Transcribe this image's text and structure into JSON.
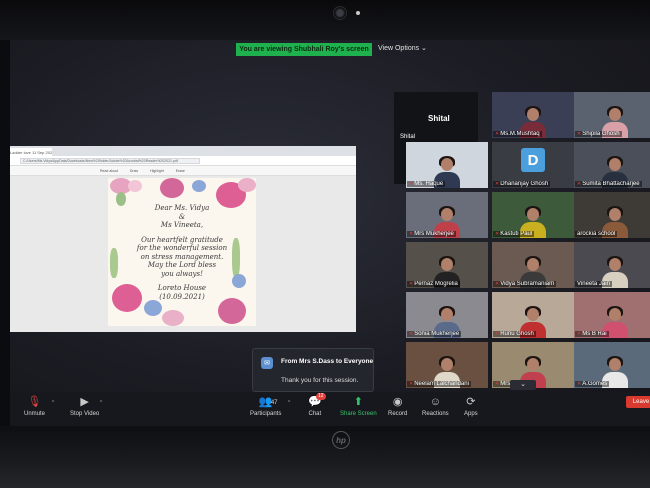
{
  "banner": {
    "text": "You are viewing Shubhali Roy's screen"
  },
  "view_options": "View Options ⌄",
  "shared_screen": {
    "tab_label": "Ladder love 11 Sep 2021 1.pdf",
    "address": "C:/Users/Ms.Vidya/AppData/Downloads/New%20folder/Adobe%20Acrobat%20Reader%202021.pdf",
    "tools": [
      "Read aloud",
      "Draw",
      "Highlight",
      "Erase"
    ],
    "card_lines": [
      "Dear Ms. Vidya",
      "&",
      "Ms Vineeta,",
      "",
      "Our heartfelt gratitude",
      "for the wonderful session",
      "on stress management.",
      "May the Lord bless",
      "you always!",
      "",
      "Loreto House",
      "(10.09.2021)"
    ]
  },
  "gallery": {
    "big_tile": {
      "name": "Shital",
      "label": "Shital"
    },
    "tiles": [
      {
        "name": "Ms.M.Mushtaq",
        "muted": true,
        "bg": "#3a3f55",
        "body": "#7a2b3a"
      },
      {
        "name": "Shipila Ghosh",
        "muted": true,
        "bg": "#5a6270",
        "body": "#d9a0a8"
      },
      {
        "name": "Ms. Haque",
        "muted": true,
        "bg": "#cfd6de",
        "body": "#2f3a52"
      },
      {
        "name": "Dhananjay Ghosh",
        "muted": true,
        "avatar": "D"
      },
      {
        "name": "Sumita Bhattacharjee",
        "muted": true,
        "bg": "#4a4f59",
        "body": "#283040"
      },
      {
        "name": "Mrs Mukherjee",
        "muted": true,
        "bg": "#6a6e7a",
        "body": "#c0404a"
      },
      {
        "name": "Kastuti Paul",
        "muted": true,
        "bg": "#3d5a3a",
        "body": "#c8b020"
      },
      {
        "name": "arockia school",
        "muted": false,
        "bg": "#3e3a36",
        "body": "#8b5a3a"
      },
      {
        "name": "Pernaz Mogrelia",
        "muted": true,
        "bg": "#55504a",
        "body": "#222"
      },
      {
        "name": "Vidya Subramaniam",
        "muted": true,
        "bg": "#6a5a52",
        "body": "#3a3a3a"
      },
      {
        "name": "Vineeta Jain",
        "muted": false,
        "bg": "#4a4a50",
        "body": "#d7d0c0",
        "active": true
      },
      {
        "name": "Sonia Mukherjee",
        "muted": true,
        "bg": "#8a8a90",
        "body": "#5a6a8a"
      },
      {
        "name": "Runu Ghosh",
        "muted": true,
        "bg": "#b8a898",
        "body": "#c03030"
      },
      {
        "name": "Ms B Rai",
        "muted": true,
        "bg": "#a07070",
        "body": "#d05070"
      },
      {
        "name": "Neelam Lalchandani",
        "muted": true,
        "bg": "#6a5040",
        "body": "#e0d8c8"
      },
      {
        "name": "Mrs P.Arora",
        "muted": true,
        "bg": "#9a8a70",
        "body": "#c04050"
      },
      {
        "name": "A.Gomes",
        "muted": true,
        "bg": "#5a6a7a",
        "body": "#e8e8e8"
      }
    ],
    "more": "⌄"
  },
  "chat_popup": {
    "from": "From Mrs S.Dass to Everyone",
    "message": "Thank you for this session."
  },
  "toolbar": {
    "unmute": "Unmute",
    "stop_video": "Stop Video",
    "participants": "Participants",
    "participants_count": "47",
    "chat": "Chat",
    "chat_badge": "12",
    "share_screen": "Share Screen",
    "record": "Record",
    "reactions": "Reactions",
    "apps": "Apps",
    "leave": "Leave"
  },
  "hardware": {
    "brand": "hp"
  }
}
